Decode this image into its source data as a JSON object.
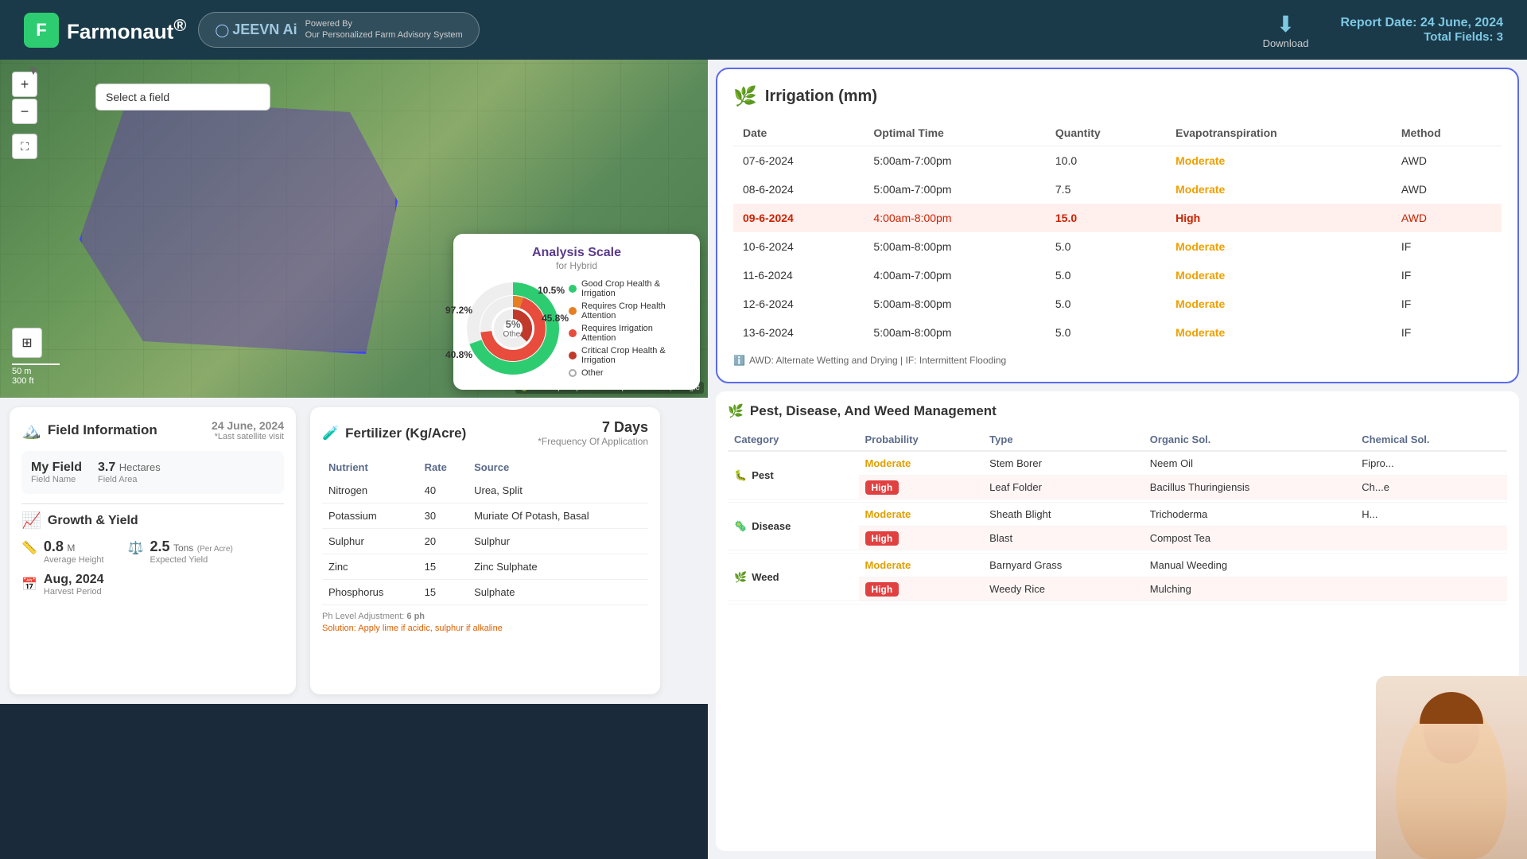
{
  "header": {
    "logo_text": "Farmonaut",
    "logo_sup": "®",
    "jeevn_title": "JEEVN Ai",
    "jeevn_powered": "Powered By",
    "jeevn_subtitle": "Our Personalized Farm Advisory System",
    "download_label": "Download",
    "report_date_label": "Report Date:",
    "report_date_value": "24 June, 2024",
    "total_fields_label": "Total Fields:",
    "total_fields_value": "3"
  },
  "map": {
    "field_select_placeholder": "Select a field",
    "zoom_in": "+",
    "zoom_out": "−",
    "scale_m": "50 m",
    "scale_ft": "300 ft",
    "attribution": "Leaflet | © OpenStreetMap contributors, Google"
  },
  "analysis_scale": {
    "title": "Analysis Scale",
    "subtitle": "for Hybrid",
    "label_972": "97.2%",
    "label_105": "10.5%",
    "label_458": "45.8%",
    "label_408": "40.8%",
    "center_other_pct": "5%",
    "center_other_label": "Other",
    "legend": [
      {
        "color": "#2ecc71",
        "label": "Good Crop Health & Irrigation"
      },
      {
        "color": "#e67e22",
        "label": "Requires Crop Health Attention"
      },
      {
        "color": "#e74c3c",
        "label": "Requires Irrigation Attention"
      },
      {
        "color": "#c0392b",
        "label": "Critical Crop Health & Irrigation"
      },
      {
        "color": "#bbb",
        "label": "Other",
        "outline": true
      }
    ]
  },
  "irrigation": {
    "title": "Irrigation (mm)",
    "icon": "🌿",
    "columns": [
      "Date",
      "Optimal Time",
      "Quantity",
      "Evapotranspiration",
      "Method"
    ],
    "rows": [
      {
        "date": "07-6-2024",
        "time": "5:00am-7:00pm",
        "qty": "10.0",
        "evapo": "Moderate",
        "method": "AWD",
        "highlight": false
      },
      {
        "date": "08-6-2024",
        "time": "5:00am-7:00pm",
        "qty": "7.5",
        "evapo": "Moderate",
        "method": "AWD",
        "highlight": false
      },
      {
        "date": "09-6-2024",
        "time": "4:00am-8:00pm",
        "qty": "15.0",
        "evapo": "High",
        "method": "AWD",
        "highlight": true
      },
      {
        "date": "10-6-2024",
        "time": "5:00am-8:00pm",
        "qty": "5.0",
        "evapo": "Moderate",
        "method": "IF",
        "highlight": false
      },
      {
        "date": "11-6-2024",
        "time": "4:00am-7:00pm",
        "qty": "5.0",
        "evapo": "Moderate",
        "method": "IF",
        "highlight": false
      },
      {
        "date": "12-6-2024",
        "time": "5:00am-8:00pm",
        "qty": "5.0",
        "evapo": "Moderate",
        "method": "IF",
        "highlight": false
      },
      {
        "date": "13-6-2024",
        "time": "5:00am-8:00pm",
        "qty": "5.0",
        "evapo": "Moderate",
        "method": "IF",
        "highlight": false
      }
    ],
    "note": "AWD: Alternate Wetting and Drying | IF: Intermittent Flooding"
  },
  "field_info": {
    "title": "Field Information",
    "icon": "🏔️",
    "date": "24 June, 2024",
    "last_visit_label": "*Last satellite visit",
    "field_name_label": "Field Name",
    "field_name_value": "My Field",
    "field_area_label": "Field Area",
    "field_area_value": "3.7",
    "field_area_unit": "Hectares"
  },
  "growth": {
    "title": "Growth & Yield",
    "icon": "📈",
    "height_value": "0.8",
    "height_unit": "M",
    "height_label": "Average Height",
    "yield_value": "2.5",
    "yield_unit": "Tons",
    "yield_per": "(Per Acre)",
    "yield_label": "Expected Yield",
    "harvest_month": "Aug, 2024",
    "harvest_label": "Harvest Period"
  },
  "fertilizer": {
    "title": "Fertilizer (Kg/Acre)",
    "icon": "🧪",
    "freq_days": "7 Days",
    "freq_label": "*Frequency Of Application",
    "columns": [
      "Nutrient",
      "Rate",
      "Source"
    ],
    "rows": [
      {
        "nutrient": "Nitrogen",
        "rate": "40",
        "source": "Urea, Split"
      },
      {
        "nutrient": "Potassium",
        "rate": "30",
        "source": "Muriate Of Potash, Basal"
      },
      {
        "nutrient": "Sulphur",
        "rate": "20",
        "source": "Sulphur"
      },
      {
        "nutrient": "Zinc",
        "rate": "15",
        "source": "Zinc Sulphate"
      },
      {
        "nutrient": "Phosphorus",
        "rate": "15",
        "source": "Sulphate"
      }
    ],
    "ph_label": "Ph Level Adjustment:",
    "ph_value": "6 ph",
    "solution_label": "Solution:",
    "solution_value": "Apply lime if acidic, sulphur if alkaline"
  },
  "pest": {
    "title": "Pest, Disease, And Weed Management",
    "icon": "🌿",
    "columns": [
      "Category",
      "Probability",
      "Type",
      "Organic Sol.",
      "Chemical Sol."
    ],
    "categories": [
      {
        "name": "Pest",
        "icon": "🐛",
        "color": "#e04040",
        "rows": [
          {
            "prob": "Moderate",
            "prob_high": false,
            "type": "Stem Borer",
            "organic": "Neem Oil",
            "chemical": "Fipro..."
          },
          {
            "prob": "High",
            "prob_high": true,
            "type": "Leaf Folder",
            "organic": "Bacillus Thuringiensis",
            "chemical": "Ch...e"
          }
        ]
      },
      {
        "name": "Disease",
        "icon": "🦠",
        "color": "#aa44cc",
        "rows": [
          {
            "prob": "Moderate",
            "prob_high": false,
            "type": "Sheath Blight",
            "organic": "Trichoderma",
            "chemical": "H..."
          },
          {
            "prob": "High",
            "prob_high": true,
            "type": "Blast",
            "organic": "Compost Tea",
            "chemical": ""
          }
        ]
      },
      {
        "name": "Weed",
        "icon": "🌿",
        "color": "#44aa44",
        "rows": [
          {
            "prob": "Moderate",
            "prob_high": false,
            "type": "Barnyard Grass",
            "organic": "Manual Weeding",
            "chemical": ""
          },
          {
            "prob": "High",
            "prob_high": true,
            "type": "Weedy Rice",
            "organic": "Mulching",
            "chemical": ""
          }
        ]
      }
    ]
  }
}
